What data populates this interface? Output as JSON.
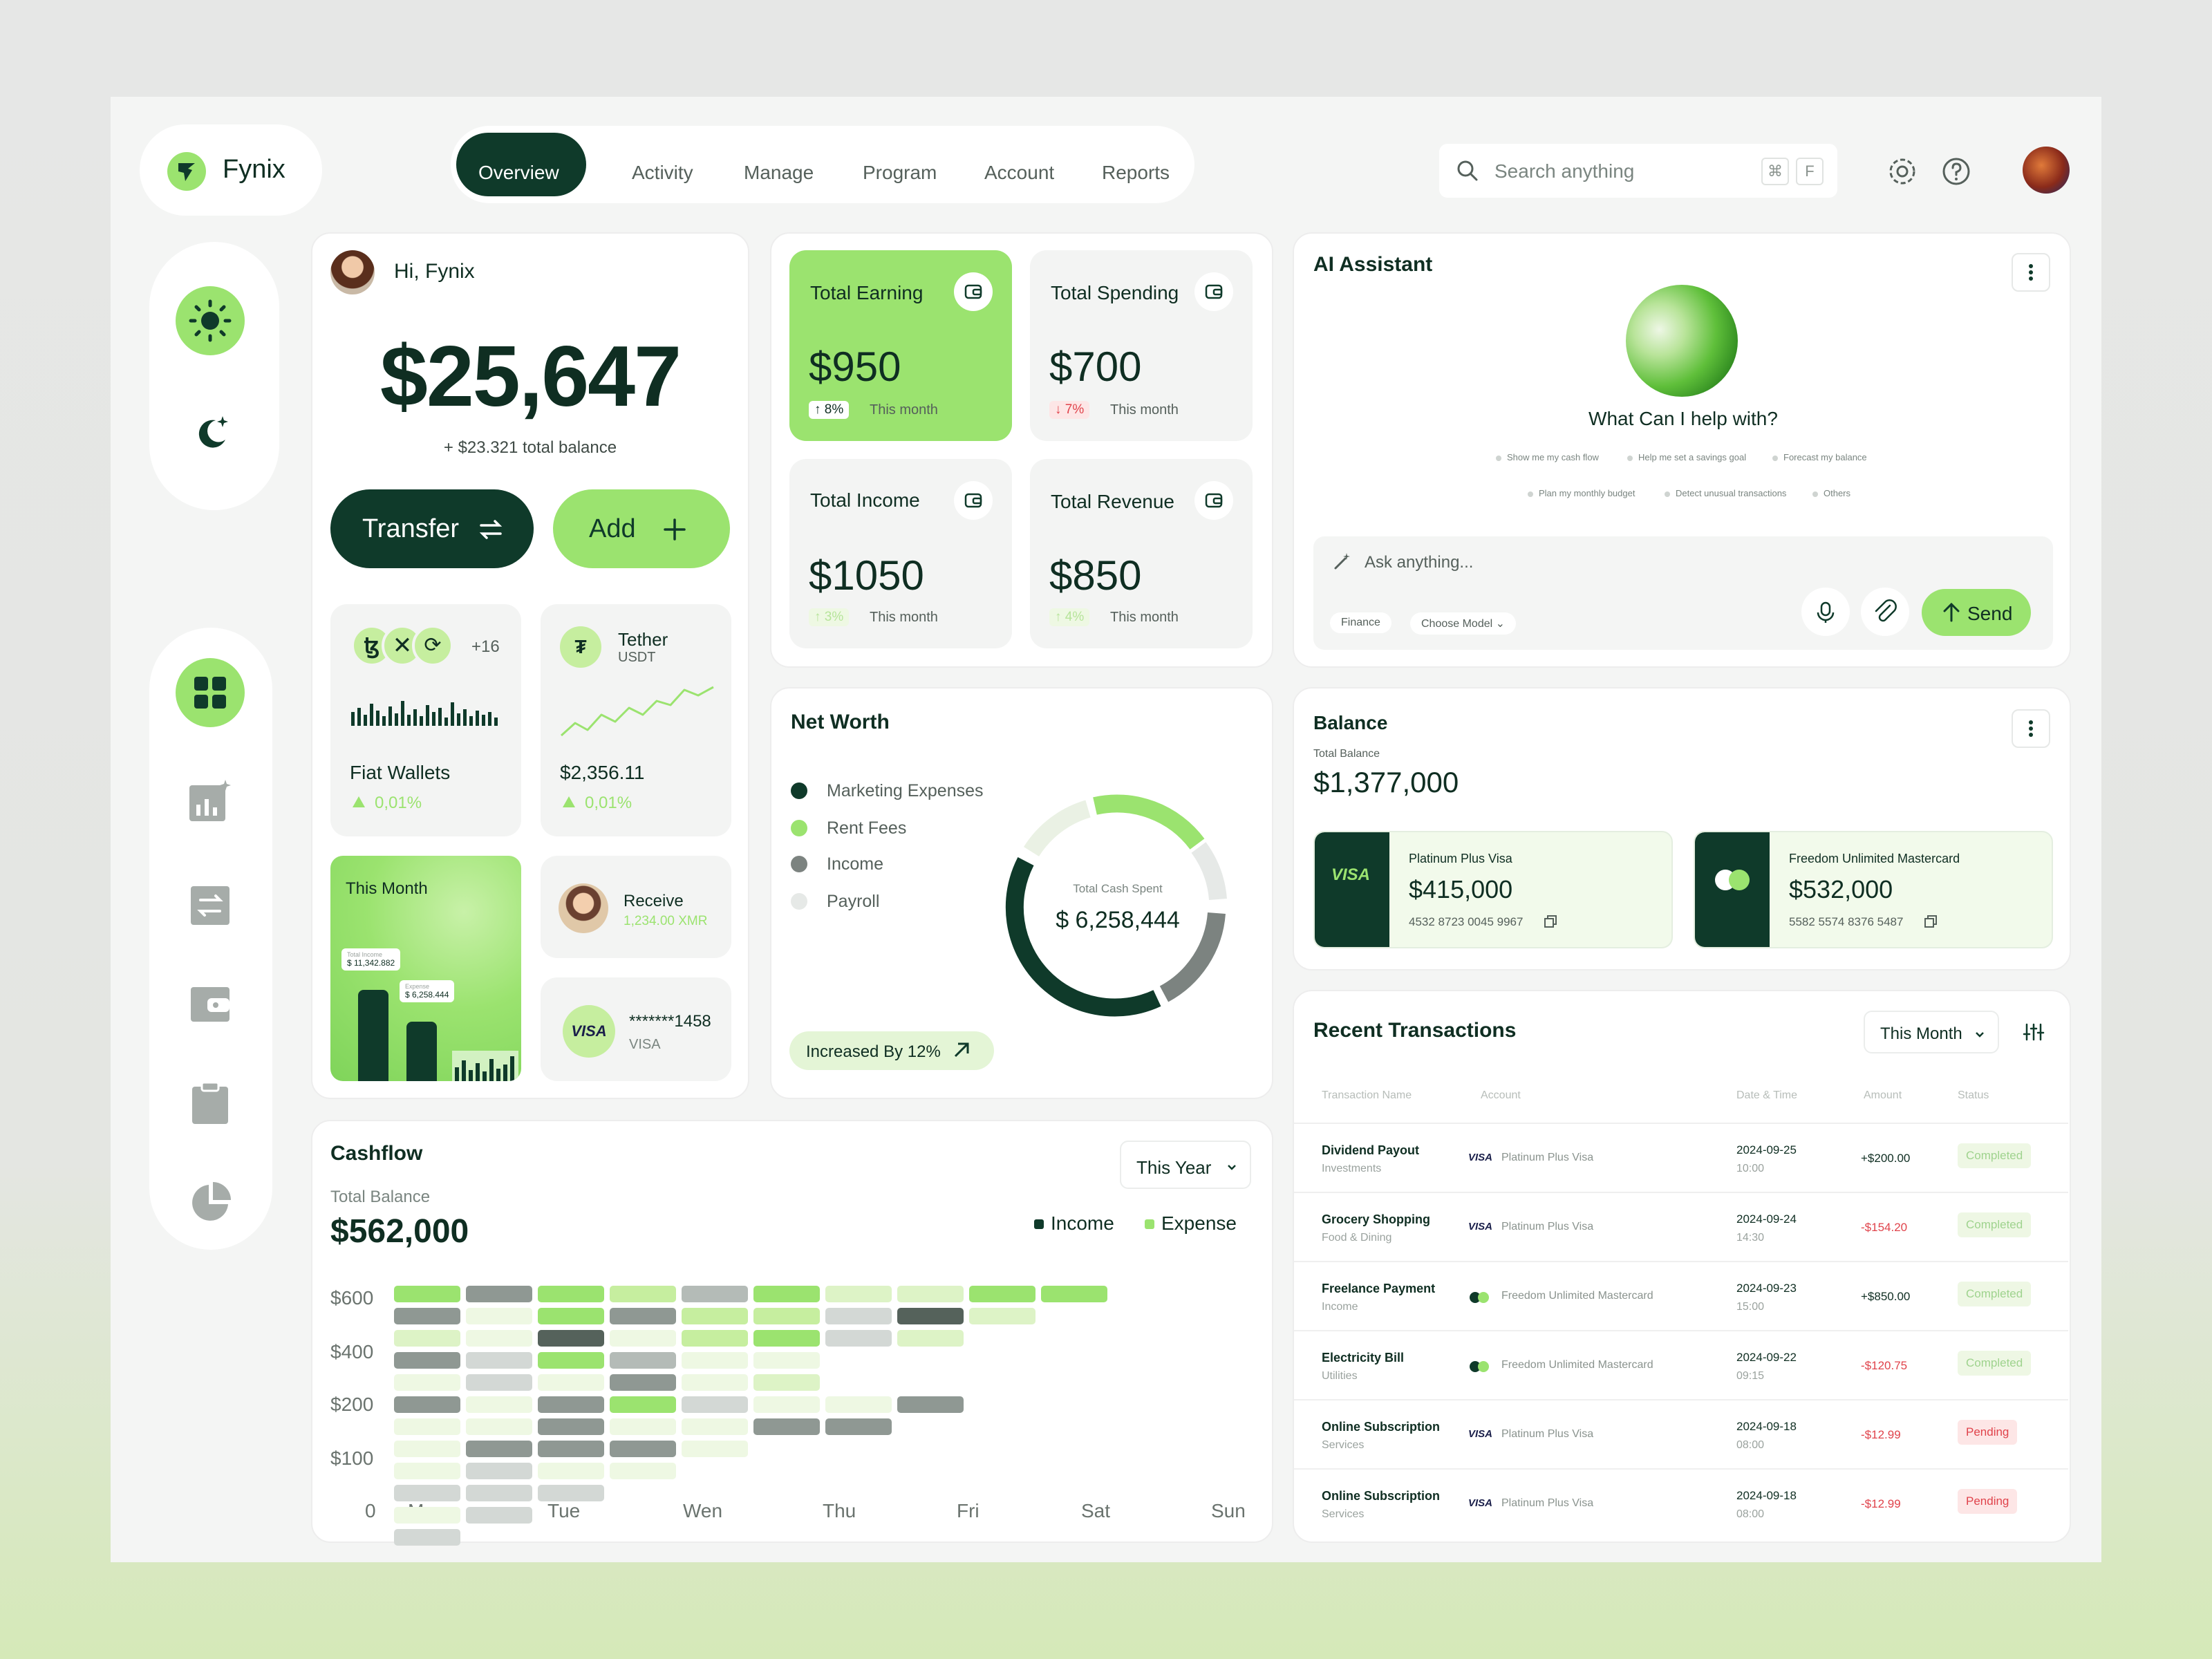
{
  "brand": {
    "name": "Fynix"
  },
  "nav": {
    "tabs": [
      "Overview",
      "Activity",
      "Manage",
      "Program",
      "Account",
      "Reports"
    ]
  },
  "search": {
    "placeholder": "Search anything",
    "key1": "⌘",
    "key2": "F"
  },
  "greeting": {
    "text": "Hi, Fynix",
    "balance": "$25,647",
    "total_note": "+ $23.321 total balance",
    "transfer": "Transfer",
    "add": "Add"
  },
  "fiat": {
    "more": "+16",
    "label": "Fiat Wallets",
    "change": "0,01%"
  },
  "tether": {
    "name": "Tether",
    "symbol": "USDT",
    "value": "$2,356.11",
    "change": "0,01%"
  },
  "this_month": {
    "label": "This Month",
    "income_label": "Total Income",
    "income_value": "$ 11,342.882",
    "exp_label": "Expense",
    "exp_value": "$ 6,258.444"
  },
  "receive": {
    "label": "Receive",
    "amount": "1,234.00 XMR"
  },
  "card_mini": {
    "number": "*******1458",
    "brand": "VISA"
  },
  "stats": [
    {
      "title": "Total Earning",
      "value": "$950",
      "change": "8%",
      "period": "This month"
    },
    {
      "title": "Total Spending",
      "value": "$700",
      "change": "7%",
      "period": "This month"
    },
    {
      "title": "Total Income",
      "value": "$1050",
      "change": "3%",
      "period": "This month"
    },
    {
      "title": "Total Revenue",
      "value": "$850",
      "change": "4%",
      "period": "This month"
    }
  ],
  "net_worth": {
    "title": "Net Worth",
    "legend": [
      "Marketing Expenses",
      "Rent Fees",
      "Income",
      "Payroll"
    ],
    "center_label": "Total Cash Spent",
    "center_value": "$ 6,258,444",
    "increase": "Increased By 12%",
    "colors": [
      "#0f3a2a",
      "#9be36f",
      "#7c8380",
      "#e6e9e7"
    ]
  },
  "ai": {
    "title": "AI Assistant",
    "question": "What Can I help with?",
    "chips": [
      "Show me my cash flow",
      "Help me set a savings goal",
      "Forecast my balance",
      "Plan my monthly budget",
      "Detect unusual transactions",
      "Others"
    ],
    "input_placeholder": "Ask anything...",
    "tag1": "Finance",
    "tag2": "Choose Model",
    "send": "Send"
  },
  "balance": {
    "title": "Balance",
    "label": "Total Balance",
    "value": "$1,377,000",
    "cards": [
      {
        "name": "Platinum Plus Visa",
        "brand": "VISA",
        "value": "$415,000",
        "number": "4532 8723 0045 9967"
      },
      {
        "name": "Freedom Unlimited Mastercard",
        "value": "$532,000",
        "number": "5582 5574 8376 5487"
      }
    ]
  },
  "transactions": {
    "title": "Recent Transactions",
    "filter": "This Month",
    "headers": [
      "Transaction Name",
      "Account",
      "Date & Time",
      "Amount",
      "Status"
    ],
    "rows": [
      {
        "name": "Dividend Payout",
        "cat": "Investments",
        "brand": "VISA",
        "account": "Platinum Plus Visa",
        "date": "2024-09-25",
        "time": "10:00",
        "amount": "+$200.00",
        "status": "Completed"
      },
      {
        "name": "Grocery Shopping",
        "cat": "Food & Dining",
        "brand": "VISA",
        "account": "Platinum Plus Visa",
        "date": "2024-09-24",
        "time": "14:30",
        "amount": "-$154.20",
        "status": "Completed"
      },
      {
        "name": "Freelance Payment",
        "cat": "Income",
        "brand": "",
        "account": "Freedom Unlimited Mastercard",
        "date": "2024-09-23",
        "time": "15:00",
        "amount": "+$850.00",
        "status": "Completed"
      },
      {
        "name": "Electricity Bill",
        "cat": "Utilities",
        "brand": "",
        "account": "Freedom Unlimited Mastercard",
        "date": "2024-09-22",
        "time": "09:15",
        "amount": "-$120.75",
        "status": "Completed"
      },
      {
        "name": "Online Subscription",
        "cat": "Services",
        "brand": "VISA",
        "account": "Platinum Plus Visa",
        "date": "2024-09-18",
        "time": "08:00",
        "amount": "-$12.99",
        "status": "Pending"
      },
      {
        "name": "Online Subscription",
        "cat": "Services",
        "brand": "VISA",
        "account": "Platinum Plus Visa",
        "date": "2024-09-18",
        "time": "08:00",
        "amount": "-$12.99",
        "status": "Pending"
      }
    ]
  },
  "cashflow": {
    "title": "Cashflow",
    "filter": "This Year",
    "label": "Total Balance",
    "value": "$562,000",
    "legend": [
      "Income",
      "Expense"
    ]
  },
  "chart_data": {
    "type": "heatmap",
    "title": "Cashflow",
    "categories": [
      "Mon",
      "Tue",
      "Wen",
      "Thu",
      "Fri",
      "Sat",
      "Sun"
    ],
    "y_ticks": [
      "$600",
      "$400",
      "$200",
      "$100",
      "0"
    ],
    "columns": [
      [
        "g4",
        "gr3",
        "g4",
        "g3",
        "gr2",
        "g4",
        "g2",
        "g2",
        "g4",
        "g4"
      ],
      [
        "gr3",
        "g1",
        "g4",
        "gr3",
        "g3",
        "g3",
        "gr1",
        "gr4",
        "g2",
        ""
      ],
      [
        "g2",
        "g1",
        "gr4",
        "g1",
        "g3",
        "g4",
        "gr1",
        "g2",
        "",
        ""
      ],
      [
        "gr3",
        "gr1",
        "g4",
        "gr2",
        "g1",
        "g1",
        "",
        "",
        "",
        ""
      ],
      [
        "g1",
        "gr1",
        "g1",
        "gr3",
        "g1",
        "g2",
        "",
        "",
        "",
        ""
      ],
      [
        "gr3",
        "g1",
        "gr3",
        "g4",
        "gr1",
        "g1",
        "g1",
        "gr3",
        "",
        ""
      ],
      [
        "g1",
        "g1",
        "gr3",
        "g1",
        "g1",
        "gr3",
        "gr3",
        "",
        "",
        ""
      ],
      [
        "g1",
        "gr3",
        "gr3",
        "gr3",
        "g1",
        "",
        "",
        "",
        "",
        ""
      ],
      [
        "g1",
        "gr1",
        "g1",
        "g1",
        "",
        "",
        "",
        "",
        "",
        ""
      ],
      [
        "gr1",
        "gr1",
        "gr1",
        "",
        "",
        "",
        "",
        "",
        "",
        ""
      ],
      [
        "g1",
        "gr1",
        "",
        "",
        "",
        "",
        "",
        "",
        "",
        ""
      ],
      [
        "gr1",
        "",
        "",
        "",
        "",
        "",
        "",
        "",
        "",
        ""
      ]
    ],
    "palette": {
      "g4": "#9be36f",
      "g3": "#c6ee9f",
      "g2": "#ddf3c6",
      "g1": "#eef8e3",
      "gr4": "#55625b",
      "gr3": "#8f9893",
      "gr2": "#b4bbb7",
      "gr1": "#d3d8d5"
    },
    "legend": [
      "Income",
      "Expense"
    ]
  },
  "colors": {
    "accent": "#9be36f",
    "dark": "#0f3a2a",
    "red": "#e0434b"
  }
}
